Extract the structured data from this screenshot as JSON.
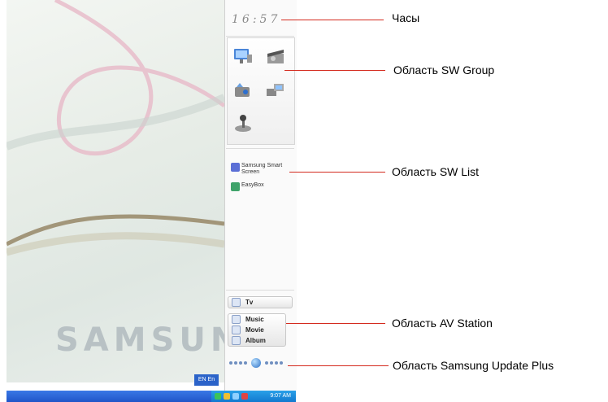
{
  "desktop": {
    "brand_text": "SAMSUN",
    "language_indicator": "EN En",
    "tray_time": "9:07 AM"
  },
  "panel": {
    "clock": "16:57",
    "sw_list": [
      {
        "name": "Samsung Smart Screen",
        "icon": "smart-screen-icon"
      },
      {
        "name": "EasyBox",
        "icon": "easybox-icon"
      }
    ],
    "av_station": [
      "Tv",
      "Music",
      "Movie",
      "Album"
    ]
  },
  "callouts": {
    "clock": "Часы",
    "sw_group": "Область SW Group",
    "sw_list": "Область SW List",
    "av_station": "Область AV Station",
    "update_plus": "Область Samsung Update Plus"
  },
  "colors": {
    "leader_line": "#d42a1e",
    "taskbar": "#1f55c8"
  }
}
